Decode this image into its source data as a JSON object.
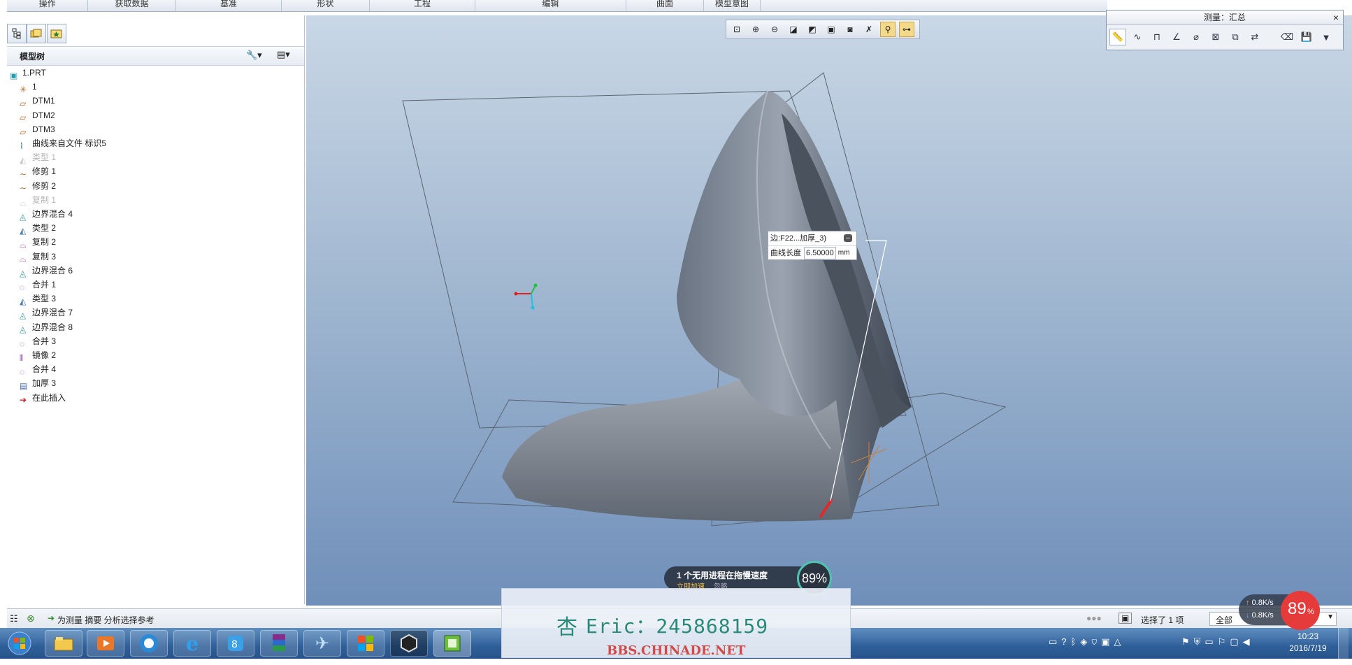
{
  "menubar": {
    "items": [
      "操作",
      "获取数据",
      "基准",
      "形状",
      "工程",
      "编辑",
      "曲面",
      "模型意图"
    ]
  },
  "left_panel": {
    "title": "模型树",
    "tree": [
      {
        "label": "1.PRT",
        "icon": "part-icon",
        "indent": 0,
        "dim": false
      },
      {
        "label": "1",
        "icon": "csys-icon",
        "indent": 1,
        "dim": false
      },
      {
        "label": "DTM1",
        "icon": "datum-plane-icon",
        "indent": 1,
        "dim": false
      },
      {
        "label": "DTM2",
        "icon": "datum-plane-icon",
        "indent": 1,
        "dim": false
      },
      {
        "label": "DTM3",
        "icon": "datum-plane-icon",
        "indent": 1,
        "dim": false
      },
      {
        "label": "曲线来自文件 标识5",
        "icon": "curve-file-icon",
        "indent": 1,
        "dim": false
      },
      {
        "label": "类型 1",
        "icon": "style-icon",
        "indent": 1,
        "dim": true
      },
      {
        "label": "修剪 1",
        "icon": "trim-curve-icon",
        "indent": 1,
        "dim": false
      },
      {
        "label": "修剪 2",
        "icon": "trim-curve-icon",
        "indent": 1,
        "dim": false
      },
      {
        "label": "复制 1",
        "icon": "copy-icon",
        "indent": 1,
        "dim": true
      },
      {
        "label": "边界混合 4",
        "icon": "boundary-blend-icon",
        "indent": 1,
        "dim": false
      },
      {
        "label": "类型 2",
        "icon": "style-icon",
        "indent": 1,
        "dim": false
      },
      {
        "label": "复制 2",
        "icon": "copy-icon",
        "indent": 1,
        "dim": false
      },
      {
        "label": "复制 3",
        "icon": "copy-icon",
        "indent": 1,
        "dim": false
      },
      {
        "label": "边界混合 6",
        "icon": "boundary-blend-icon",
        "indent": 1,
        "dim": false
      },
      {
        "label": "合并 1",
        "icon": "merge-icon",
        "indent": 1,
        "dim": false
      },
      {
        "label": "类型 3",
        "icon": "style-icon",
        "indent": 1,
        "dim": false
      },
      {
        "label": "边界混合 7",
        "icon": "boundary-blend-icon",
        "indent": 1,
        "dim": false
      },
      {
        "label": "边界混合 8",
        "icon": "boundary-blend-icon",
        "indent": 1,
        "dim": false
      },
      {
        "label": "合并 3",
        "icon": "merge-icon",
        "indent": 1,
        "dim": false
      },
      {
        "label": "镜像 2",
        "icon": "mirror-icon",
        "indent": 1,
        "dim": false
      },
      {
        "label": "合并 4",
        "icon": "merge-icon",
        "indent": 1,
        "dim": false
      },
      {
        "label": "加厚 3",
        "icon": "thicken-icon",
        "indent": 1,
        "dim": false
      },
      {
        "label": "在此插入",
        "icon": "insert-here-arrow-icon",
        "indent": 1,
        "dim": false
      }
    ]
  },
  "view_toolbar": {
    "buttons": [
      "refit-icon",
      "zoom-in-icon",
      "zoom-out-icon",
      "repaint-icon",
      "display-style-icon",
      "saved-views-icon",
      "view-manager-icon",
      "datum-display-icon",
      "spin-center-icon",
      "annotation-display-icon"
    ]
  },
  "measure_dialog": {
    "title": "测量：汇总",
    "close": "×",
    "tools": [
      "measure-summary-icon",
      "length-icon",
      "distance-icon",
      "angle-icon",
      "diameter-icon",
      "area-icon",
      "volume-icon",
      "transform-icon",
      "eraser-icon",
      "save-icon",
      "more-icon"
    ]
  },
  "annotation": {
    "edge_label": "边:F22...加厚_3)",
    "length_label": "曲线长度",
    "length_value": "6.50000",
    "unit": "mm"
  },
  "status": {
    "message": "为测量 摘要 分析选择参考",
    "selection": "选择了 1 项",
    "filter": "全部"
  },
  "toast": {
    "text": "1 个无用进程在拖慢速度",
    "sub": "立即加速",
    "sub2": "忽略",
    "percent": "89%"
  },
  "watermark": {
    "line1": "Eric：245868159",
    "line2": "BBS.CHINADE.NET"
  },
  "netspeed": {
    "up": "0.8K/s",
    "down": "0.8K/s",
    "cpu": "89",
    "cpu_unit": "%"
  },
  "clock": {
    "time": "10:23",
    "date": "2016/7/19"
  },
  "taskbar": {
    "apps": [
      "start-orb-icon",
      "explorer-icon",
      "media-player-icon",
      "cloud-app-icon",
      "internet-explorer-icon",
      "app-icon",
      "winrar-icon",
      "bird-app-icon",
      "tiles-app-icon",
      "hex-app-icon",
      "creo-app-icon"
    ]
  }
}
